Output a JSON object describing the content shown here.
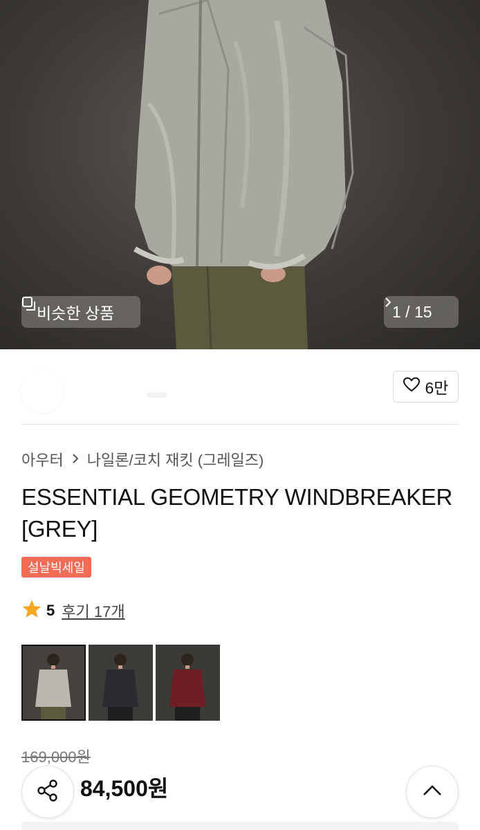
{
  "hero": {
    "similar_label": "비슷한 상품",
    "counter": "1 / 15"
  },
  "seller": {
    "likes": "6만"
  },
  "product": {
    "category_parent": "아우터",
    "category_child": "나일론/코치 재킷 (그레일즈)",
    "title": "ESSENTIAL GEOMETRY WINDBREAKER [GREY]",
    "badge": "설날빅세일",
    "rating": "5",
    "reviews": "후기 17개",
    "original_price": "169,000원",
    "sale_price": "84,500원"
  },
  "colors": {
    "badge": "#f26b55",
    "star": "#f5a623"
  },
  "thumbnails": [
    {
      "name": "grey",
      "jacket": "#b9b7ae"
    },
    {
      "name": "black",
      "jacket": "#2a2a30"
    },
    {
      "name": "burgundy",
      "jacket": "#6e1e24"
    }
  ]
}
